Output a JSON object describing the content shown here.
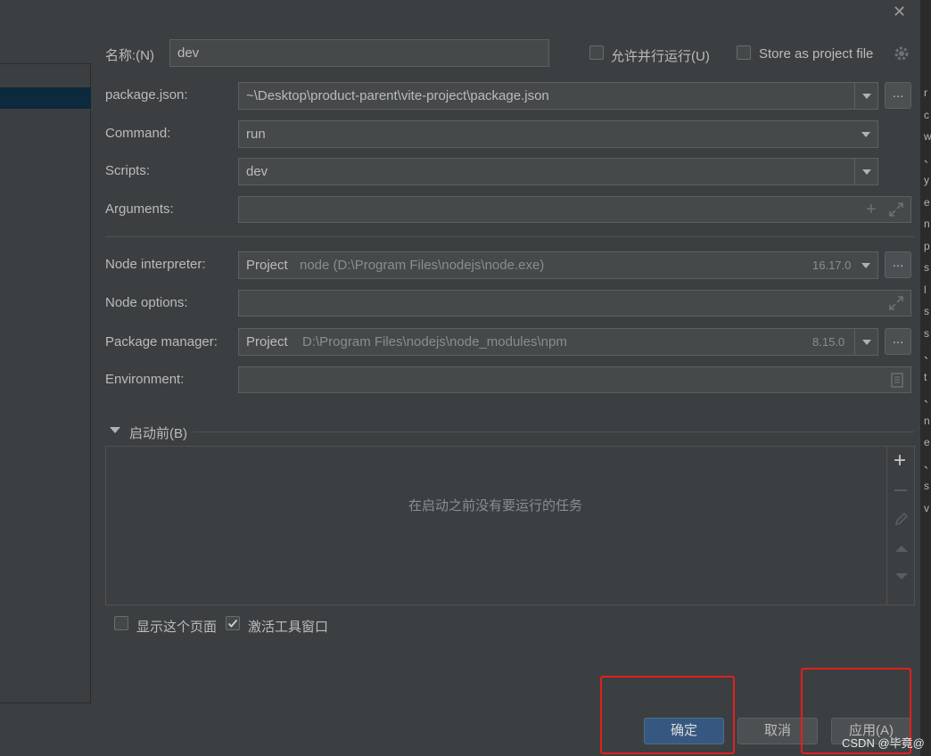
{
  "title_bar": {
    "close_glyph": "✕"
  },
  "name_row": {
    "label": "名称:(N)",
    "value": "dev",
    "allow_parallel_label": "允许并行运行(U)",
    "store_project_label": "Store as project file"
  },
  "fields": {
    "package_json": {
      "label": "package.json:",
      "value": "~\\Desktop\\product-parent\\vite-project\\package.json"
    },
    "command": {
      "label": "Command:",
      "value": "run"
    },
    "scripts": {
      "label": "Scripts:",
      "value": "dev"
    },
    "arguments": {
      "label": "Arguments:",
      "value": ""
    },
    "node_interpreter": {
      "label": "Node interpreter:",
      "prefix": "Project",
      "value": "node (D:\\Program Files\\nodejs\\node.exe)",
      "version": "16.17.0"
    },
    "node_options": {
      "label": "Node options:",
      "value": ""
    },
    "package_manager": {
      "label": "Package manager:",
      "prefix": "Project",
      "value": "D:\\Program Files\\nodejs\\node_modules\\npm",
      "version": "8.15.0"
    },
    "environment": {
      "label": "Environment:",
      "value": ""
    }
  },
  "before_launch": {
    "header": "启动前(B)",
    "empty_text": "在启动之前没有要运行的任务",
    "show_page_label": "显示这个页面",
    "activate_window_label": "激活工具窗口",
    "show_page_checked": false,
    "activate_window_checked": true
  },
  "buttons": {
    "ok": "确定",
    "cancel": "取消",
    "apply": "应用(A)"
  },
  "right_edge_letters": [
    "r",
    "c",
    "w",
    "、",
    "y",
    "e",
    "n",
    "p",
    "s",
    "l",
    "s",
    "s",
    "、",
    "t",
    "、",
    "n",
    "e",
    "、",
    "s",
    "v"
  ],
  "watermark": "CSDN @毕竟@",
  "colors": {
    "accent": "#365880",
    "highlight_box": "#e0201f",
    "background": "#3c3f41"
  }
}
